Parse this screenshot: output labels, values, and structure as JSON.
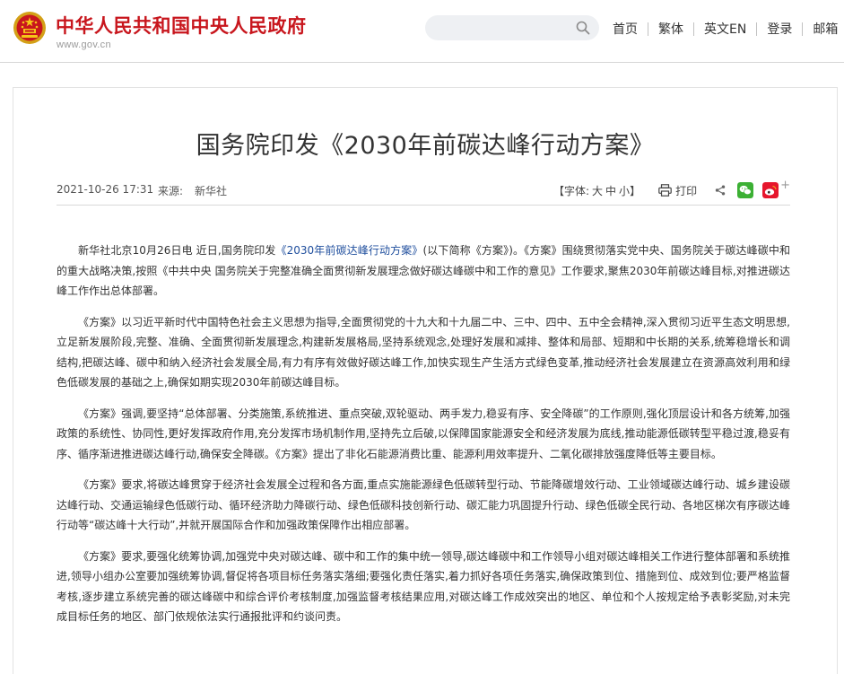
{
  "header": {
    "site_title": "中华人民共和国中央人民政府",
    "site_url": "www.gov.cn",
    "search_placeholder": "",
    "nav": [
      "首页",
      "繁体",
      "英文EN",
      "登录",
      "邮箱"
    ],
    "brand_color": "#c8161d"
  },
  "article": {
    "title": "国务院印发《2030年前碳达峰行动方案》",
    "date": "2021-10-26 17:31",
    "source_label": "来源:",
    "source": "新华社",
    "font_size_label": "【字体:",
    "font_sizes": [
      "大",
      "中",
      "小"
    ],
    "font_size_close": "】",
    "print_label": "打印",
    "share_icons": [
      "share-icon",
      "wechat-icon",
      "weibo-icon"
    ],
    "paragraphs": [
      {
        "pre": "新华社北京10月26日电 近日,国务院印发",
        "link": "《2030年前碳达峰行动方案》",
        "post": "(以下简称《方案》)。《方案》围绕贯彻落实党中央、国务院关于碳达峰碳中和的重大战略决策,按照《中共中央 国务院关于完整准确全面贯彻新发展理念做好碳达峰碳中和工作的意见》工作要求,聚焦2030年前碳达峰目标,对推进碳达峰工作作出总体部署。"
      },
      {
        "text": "《方案》以习近平新时代中国特色社会主义思想为指导,全面贯彻党的十九大和十九届二中、三中、四中、五中全会精神,深入贯彻习近平生态文明思想,立足新发展阶段,完整、准确、全面贯彻新发展理念,构建新发展格局,坚持系统观念,处理好发展和减排、整体和局部、短期和中长期的关系,统筹稳增长和调结构,把碳达峰、碳中和纳入经济社会发展全局,有力有序有效做好碳达峰工作,加快实现生产生活方式绿色变革,推动经济社会发展建立在资源高效利用和绿色低碳发展的基础之上,确保如期实现2030年前碳达峰目标。"
      },
      {
        "text": "《方案》强调,要坚持“总体部署、分类施策,系统推进、重点突破,双轮驱动、两手发力,稳妥有序、安全降碳”的工作原则,强化顶层设计和各方统筹,加强政策的系统性、协同性,更好发挥政府作用,充分发挥市场机制作用,坚持先立后破,以保障国家能源安全和经济发展为底线,推动能源低碳转型平稳过渡,稳妥有序、循序渐进推进碳达峰行动,确保安全降碳。《方案》提出了非化石能源消费比重、能源利用效率提升、二氧化碳排放强度降低等主要目标。"
      },
      {
        "text": "《方案》要求,将碳达峰贯穿于经济社会发展全过程和各方面,重点实施能源绿色低碳转型行动、节能降碳增效行动、工业领域碳达峰行动、城乡建设碳达峰行动、交通运输绿色低碳行动、循环经济助力降碳行动、绿色低碳科技创新行动、碳汇能力巩固提升行动、绿色低碳全民行动、各地区梯次有序碳达峰行动等“碳达峰十大行动”,并就开展国际合作和加强政策保障作出相应部署。"
      },
      {
        "text": "《方案》要求,要强化统筹协调,加强党中央对碳达峰、碳中和工作的集中统一领导,碳达峰碳中和工作领导小组对碳达峰相关工作进行整体部署和系统推进,领导小组办公室要加强统筹协调,督促将各项目标任务落实落细;要强化责任落实,着力抓好各项任务落实,确保政策到位、措施到位、成效到位;要严格监督考核,逐步建立系统完善的碳达峰碳中和综合评价考核制度,加强监督考核结果应用,对碳达峰工作成效突出的地区、单位和个人按规定给予表彰奖励,对未完成目标任务的地区、部门依规依法实行通报批评和约谈问责。"
      }
    ]
  }
}
